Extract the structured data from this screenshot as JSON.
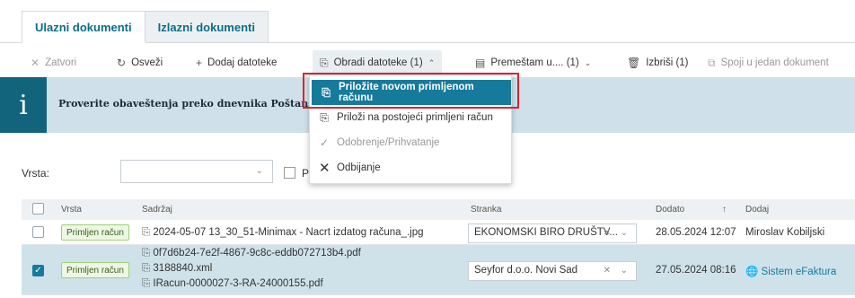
{
  "tabs": [
    {
      "label": "Ulazni dokumenti"
    },
    {
      "label": "Izlazni dokumenti"
    }
  ],
  "toolbar": {
    "close": {
      "label": "Zatvori",
      "icon": "close-icon"
    },
    "refresh": {
      "label": "Osveži",
      "icon": "refresh-icon"
    },
    "add": {
      "label": "Dodaj datoteke",
      "icon": "plus-icon"
    },
    "process": {
      "label": "Obradi datoteke (1)",
      "icon": "process-icon"
    },
    "move": {
      "label": "Premeštam u.... (1)",
      "icon": "move-icon"
    },
    "delete": {
      "label": "Izbriši (1)",
      "icon": "trash-icon"
    },
    "merge": {
      "label": "Spoji u jedan dokument",
      "icon": "merge-icon"
    }
  },
  "banner": {
    "icon_char": "i",
    "text": "Proverite obaveštenja preko dnevnika Poštans"
  },
  "dropdown": {
    "items": [
      {
        "label": "Priložite novom primljenom računu",
        "icon": "attach-icon"
      },
      {
        "label": "Priloži na postojeći primljeni račun",
        "icon": "attach-icon"
      },
      {
        "label": "Odobrenje/Prihvatanje",
        "icon": "check-icon"
      },
      {
        "label": "Odbijanje",
        "icon": "x-icon"
      }
    ]
  },
  "filter": {
    "label": "Vrsta:",
    "select_value": "",
    "check_label": "Pr"
  },
  "table": {
    "headers": {
      "vrsta": "Vrsta",
      "sadrzaj": "Sadržaj",
      "stranka": "Stranka",
      "dodato": "Dodato",
      "sort": "↑",
      "dodaj": "Dodaj"
    },
    "rows": [
      {
        "checked": false,
        "vrsta": "Primljen račun",
        "files": [
          "2024-05-07 13_30_51-Minimax - Nacrt izdatog računa_.jpg"
        ],
        "stranka": "EKONOMSKI BIRO DRUŠTV...",
        "dodato": "28.05.2024 12:07",
        "dodaj": "Miroslav Kobiljski"
      },
      {
        "checked": true,
        "vrsta": "Primljen račun",
        "files": [
          "0f7d6b24-7e2f-4867-9c8c-eddb072713b4.pdf",
          "3188840.xml",
          "IRacun-0000027-3-RA-24000155.pdf"
        ],
        "stranka": "Seyfor d.o.o. Novi Sad",
        "dodato": "27.05.2024 08:16",
        "dodaj": "Sistem eFaktura"
      }
    ]
  },
  "colors": {
    "accent": "#157a9c",
    "banner_dark": "#11647c",
    "banner_light": "#cfe0ea",
    "highlight_border": "#d9242b"
  }
}
